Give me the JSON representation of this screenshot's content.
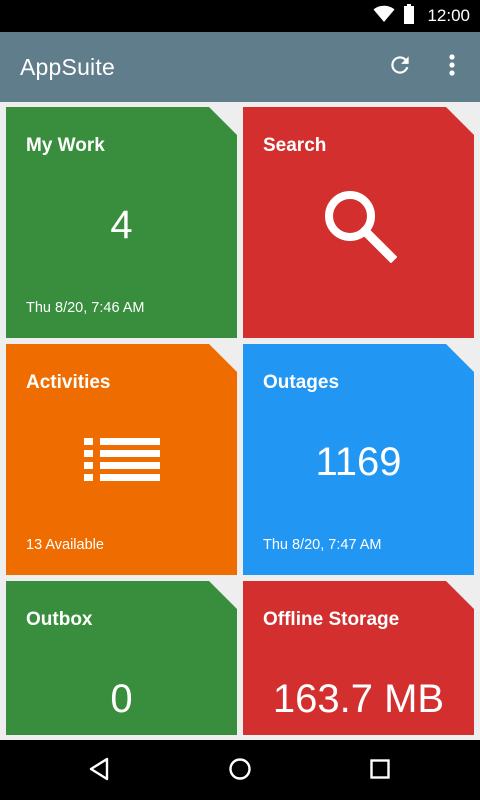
{
  "status_bar": {
    "time": "12:00",
    "icons": [
      "wifi-icon",
      "battery-icon"
    ]
  },
  "app_bar": {
    "title": "AppSuite",
    "actions": [
      "refresh-icon",
      "more-vert-icon"
    ],
    "color": "#607d8b"
  },
  "tiles": {
    "my_work": {
      "title": "My Work",
      "value": "4",
      "subtitle": "Thu 8/20, 7:46 AM",
      "color": "#388e3c"
    },
    "search": {
      "title": "Search",
      "icon": "search-icon",
      "color": "#d32f2f"
    },
    "activities": {
      "title": "Activities",
      "icon": "list-icon",
      "subtitle": "13 Available",
      "color": "#ef6c00"
    },
    "outages": {
      "title": "Outages",
      "value": "1169",
      "subtitle": "Thu 8/20, 7:47 AM",
      "color": "#2196f3"
    },
    "outbox": {
      "title": "Outbox",
      "value": "0",
      "color": "#388e3c"
    },
    "offline_storage": {
      "title": "Offline Storage",
      "value": "163.7 MB",
      "color": "#d32f2f"
    }
  },
  "nav_bar": {
    "buttons": [
      "back-icon",
      "home-icon",
      "recents-icon"
    ]
  }
}
